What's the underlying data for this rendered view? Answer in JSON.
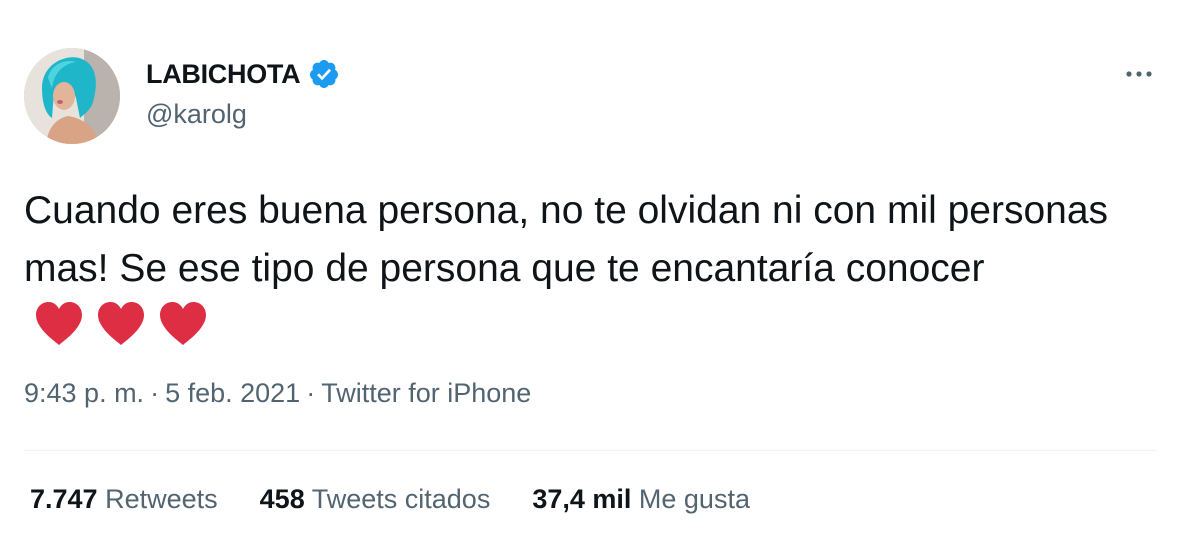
{
  "author": {
    "display_name": "LABICHOTA",
    "handle": "@karolg",
    "verified": true,
    "verified_color": "#1d9bf0"
  },
  "tweet": {
    "text": "Cuando eres buena persona, no te olvidan ni con mil personas mas! Se ese tipo de persona que te encantaría conocer",
    "emoji": [
      "red-heart",
      "red-heart",
      "red-heart"
    ],
    "heart_color": "#dd2e44"
  },
  "meta": {
    "time": "9:43 p. m.",
    "separator": "·",
    "date": "5 feb. 2021",
    "source": "Twitter for iPhone"
  },
  "stats": {
    "retweets": {
      "count": "7.747",
      "label": "Retweets"
    },
    "quotes": {
      "count": "458",
      "label": "Tweets citados"
    },
    "likes": {
      "count": "37,4 mil",
      "label": "Me gusta"
    }
  },
  "icons": {
    "more": "more-horizontal-icon",
    "verified": "verified-badge-icon"
  }
}
